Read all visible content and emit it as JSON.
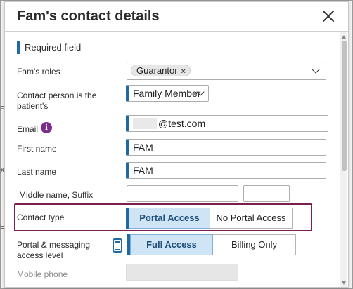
{
  "dialog": {
    "title": "Fam's contact details"
  },
  "form": {
    "required_note": "Required field",
    "roles": {
      "label": "Fam's roles",
      "chips": [
        "Guarantor"
      ]
    },
    "contact_person": {
      "label": "Contact person is the patient's",
      "value": "Family Member"
    },
    "email": {
      "label": "Email",
      "value": "@test.com",
      "info_icon": "i"
    },
    "first_name": {
      "label": "First name",
      "value": "FAM"
    },
    "last_name": {
      "label": "Last name",
      "value": "FAM"
    },
    "middle_suffix": {
      "label": "Middle name, Suffix",
      "middle": "",
      "suffix": ""
    },
    "contact_type": {
      "label": "Contact type",
      "options": [
        "Portal Access",
        "No Portal Access"
      ],
      "selected": "Portal Access"
    },
    "portal_access_level": {
      "label": "Portal & messaging access level",
      "options": [
        "Full Access",
        "Billing Only"
      ],
      "selected": "Full Access"
    },
    "mobile_phone": {
      "label": "Mobile phone",
      "value": ""
    }
  },
  "icons": {
    "close": "close-icon",
    "info": "info-icon",
    "chip_remove": "×",
    "mobile": "mobile-phone-icon"
  },
  "colors": {
    "accent": "#1f6aa5",
    "info": "#7b2d8e",
    "highlight": "#7a1f4f",
    "selected_toggle": "#cfe5f6"
  }
}
